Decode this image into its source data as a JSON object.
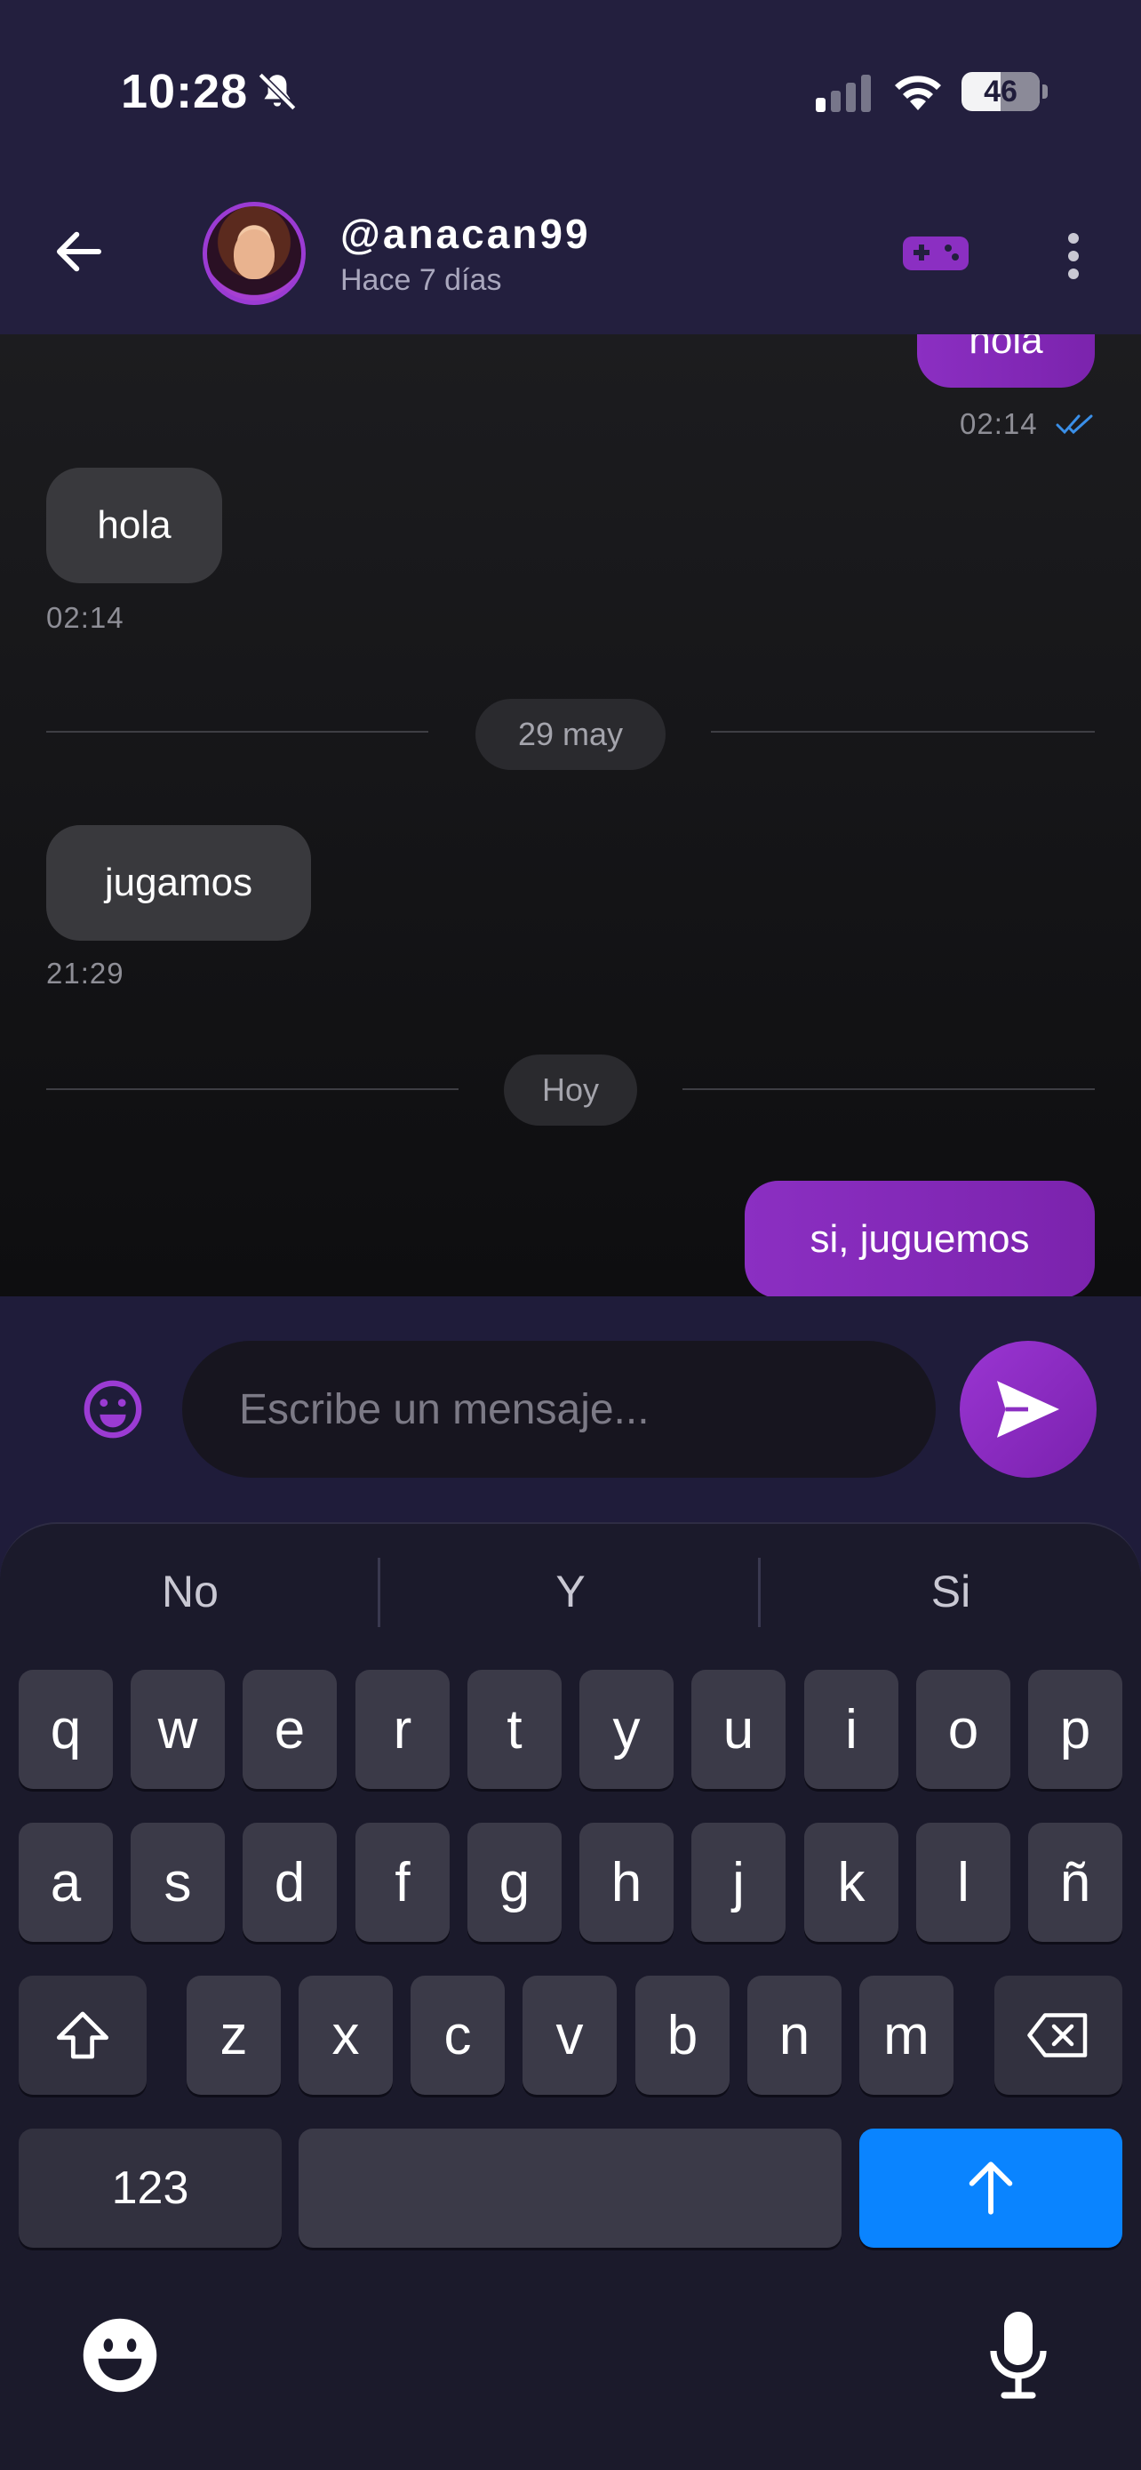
{
  "status_bar": {
    "time": "10:28",
    "battery": "46",
    "battery_level": 0.46
  },
  "header": {
    "username": "@anacan99",
    "last_seen": "Hace 7 días"
  },
  "messages": [
    {
      "direction": "out",
      "text": "hola",
      "time": "02:14",
      "read": true
    },
    {
      "direction": "in",
      "text": "hola",
      "time": "02:14"
    },
    {
      "separator": "29 may"
    },
    {
      "direction": "in",
      "text": "jugamos",
      "time": "21:29"
    },
    {
      "separator": "Hoy"
    },
    {
      "direction": "out",
      "text": "si, juguemos"
    }
  ],
  "composer": {
    "placeholder": "Escribe un mensaje..."
  },
  "keyboard": {
    "suggestions": [
      "No",
      "Y",
      "Si"
    ],
    "row1": [
      "q",
      "w",
      "e",
      "r",
      "t",
      "y",
      "u",
      "i",
      "o",
      "p"
    ],
    "row2": [
      "a",
      "s",
      "d",
      "f",
      "g",
      "h",
      "j",
      "k",
      "l",
      "ñ"
    ],
    "row3": [
      "z",
      "x",
      "c",
      "v",
      "b",
      "n",
      "m"
    ],
    "numbers_key": "123"
  },
  "colors": {
    "accent": "#8b2fc2",
    "header_bg": "#231f3e",
    "return_key": "#0a84ff"
  },
  "icons": [
    "mute-bell-icon",
    "signal-icon",
    "wifi-icon",
    "back-arrow-icon",
    "gamepad-icon",
    "more-vert-icon",
    "double-check-icon",
    "emoji-icon",
    "send-icon",
    "shift-icon",
    "backspace-icon",
    "return-arrow-icon",
    "microphone-icon"
  ]
}
